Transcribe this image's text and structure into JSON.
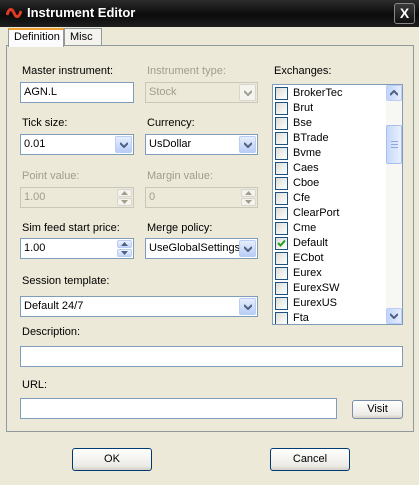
{
  "window": {
    "title": "Instrument Editor",
    "close_glyph": "X",
    "icon": "app-logo-icon"
  },
  "tabs": [
    {
      "label": "Definition",
      "active": true
    },
    {
      "label": "Misc",
      "active": false
    }
  ],
  "form": {
    "master_instrument": {
      "label": "Master instrument:",
      "value": "AGN.L"
    },
    "instrument_type": {
      "label": "Instrument type:",
      "value": "Stock",
      "disabled": true
    },
    "tick_size": {
      "label": "Tick size:",
      "value": "0.01"
    },
    "currency": {
      "label": "Currency:",
      "value": "UsDollar"
    },
    "point_value": {
      "label": "Point value:",
      "value": "1.00",
      "disabled": true
    },
    "margin_value": {
      "label": "Margin value:",
      "value": "0",
      "disabled": true
    },
    "sim_feed_start_price": {
      "label": "Sim feed start price:",
      "value": "1.00"
    },
    "merge_policy": {
      "label": "Merge policy:",
      "value": "UseGlobalSettings"
    },
    "session_template": {
      "label": "Session template:",
      "value": "Default 24/7"
    },
    "description": {
      "label": "Description:",
      "value": ""
    },
    "url": {
      "label": "URL:",
      "value": "",
      "visit_label": "Visit"
    }
  },
  "exchanges": {
    "label": "Exchanges:",
    "items": [
      {
        "name": "BrokerTec",
        "checked": false
      },
      {
        "name": "Brut",
        "checked": false
      },
      {
        "name": "Bse",
        "checked": false
      },
      {
        "name": "BTrade",
        "checked": false
      },
      {
        "name": "Bvme",
        "checked": false
      },
      {
        "name": "Caes",
        "checked": false
      },
      {
        "name": "Cboe",
        "checked": false
      },
      {
        "name": "Cfe",
        "checked": false
      },
      {
        "name": "ClearPort",
        "checked": false
      },
      {
        "name": "Cme",
        "checked": false
      },
      {
        "name": "Default",
        "checked": true
      },
      {
        "name": "ECbot",
        "checked": false
      },
      {
        "name": "Eurex",
        "checked": false
      },
      {
        "name": "EurexSW",
        "checked": false
      },
      {
        "name": "EurexUS",
        "checked": false
      },
      {
        "name": "Fta",
        "checked": false
      }
    ]
  },
  "buttons": {
    "ok": "OK",
    "cancel": "Cancel"
  },
  "colors": {
    "title_bar": "#111111",
    "window_bg": "#ece9d8",
    "field_border": "#7f9db9",
    "checkmark": "#21a121"
  }
}
